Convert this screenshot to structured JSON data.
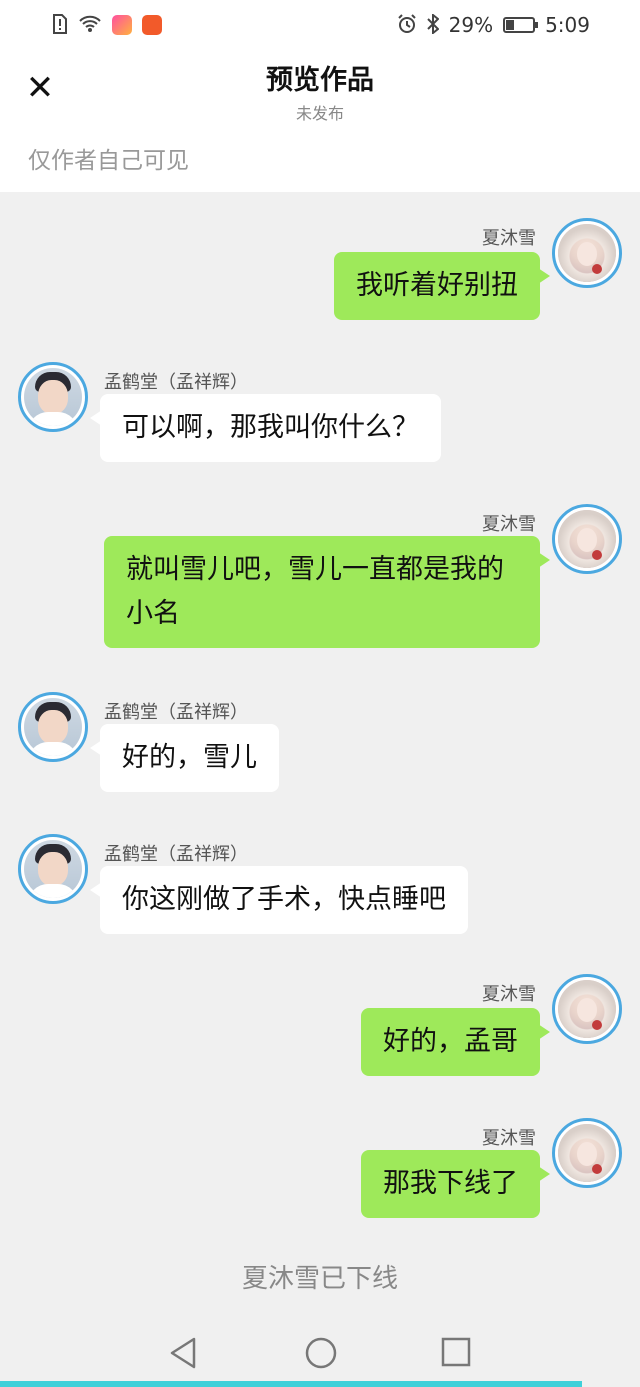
{
  "status_bar": {
    "battery": "29%",
    "time": "5:09"
  },
  "header": {
    "title": "预览作品",
    "subtitle": "未发布",
    "close_symbol": "✕"
  },
  "visibility_note": "仅作者自己可见",
  "participants": {
    "her": {
      "name": "夏沐雪"
    },
    "him": {
      "name": "孟鹤堂（孟祥辉）"
    }
  },
  "messages": [
    {
      "sender": "her",
      "name": "夏沐雪",
      "text": "我听着好别扭"
    },
    {
      "sender": "him",
      "name": "孟鹤堂（孟祥辉）",
      "text": "可以啊，那我叫你什么？"
    },
    {
      "sender": "her",
      "name": "夏沐雪",
      "text": "就叫雪儿吧，雪儿一直都是我的小名"
    },
    {
      "sender": "him",
      "name": "孟鹤堂（孟祥辉）",
      "text": "好的，雪儿"
    },
    {
      "sender": "him",
      "name": "孟鹤堂（孟祥辉）",
      "text": "你这刚做了手术，快点睡吧"
    },
    {
      "sender": "her",
      "name": "夏沐雪",
      "text": "好的，孟哥"
    },
    {
      "sender": "her",
      "name": "夏沐雪",
      "text": "那我下线了"
    }
  ],
  "system_notice": "夏沐雪已下线",
  "icons": {
    "close": "close-icon",
    "back": "nav-back-icon",
    "home": "nav-home-icon",
    "recents": "nav-recents-icon"
  },
  "colors": {
    "my_bubble": "#9ee95a",
    "other_bubble": "#ffffff",
    "avatar_border": "#4ba8e0",
    "progress": "#3fd0d9"
  },
  "progress": 0.91
}
